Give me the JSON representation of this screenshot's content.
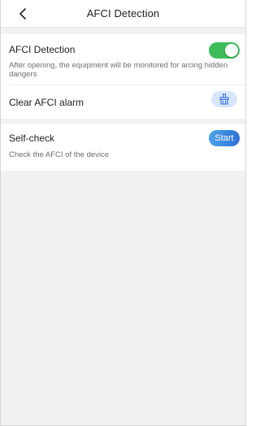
{
  "nav": {
    "title": "AFCI Detection",
    "back_icon": "chevron-left-icon"
  },
  "afci": {
    "title": "AFCI Detection",
    "description": "After opening, the equipment will be monitored for arcing hidden dangers",
    "toggle_on": true,
    "toggle_color": "#3ebc5a"
  },
  "clear_alarm": {
    "title": "Clear AFCI alarm",
    "icon": "clear-broom-icon",
    "button_color": "#d8e6fb"
  },
  "self_check": {
    "title": "Self-check",
    "description": "Check the AFCI of the device",
    "button_label": "Start",
    "button_color": "#3a86e0"
  }
}
